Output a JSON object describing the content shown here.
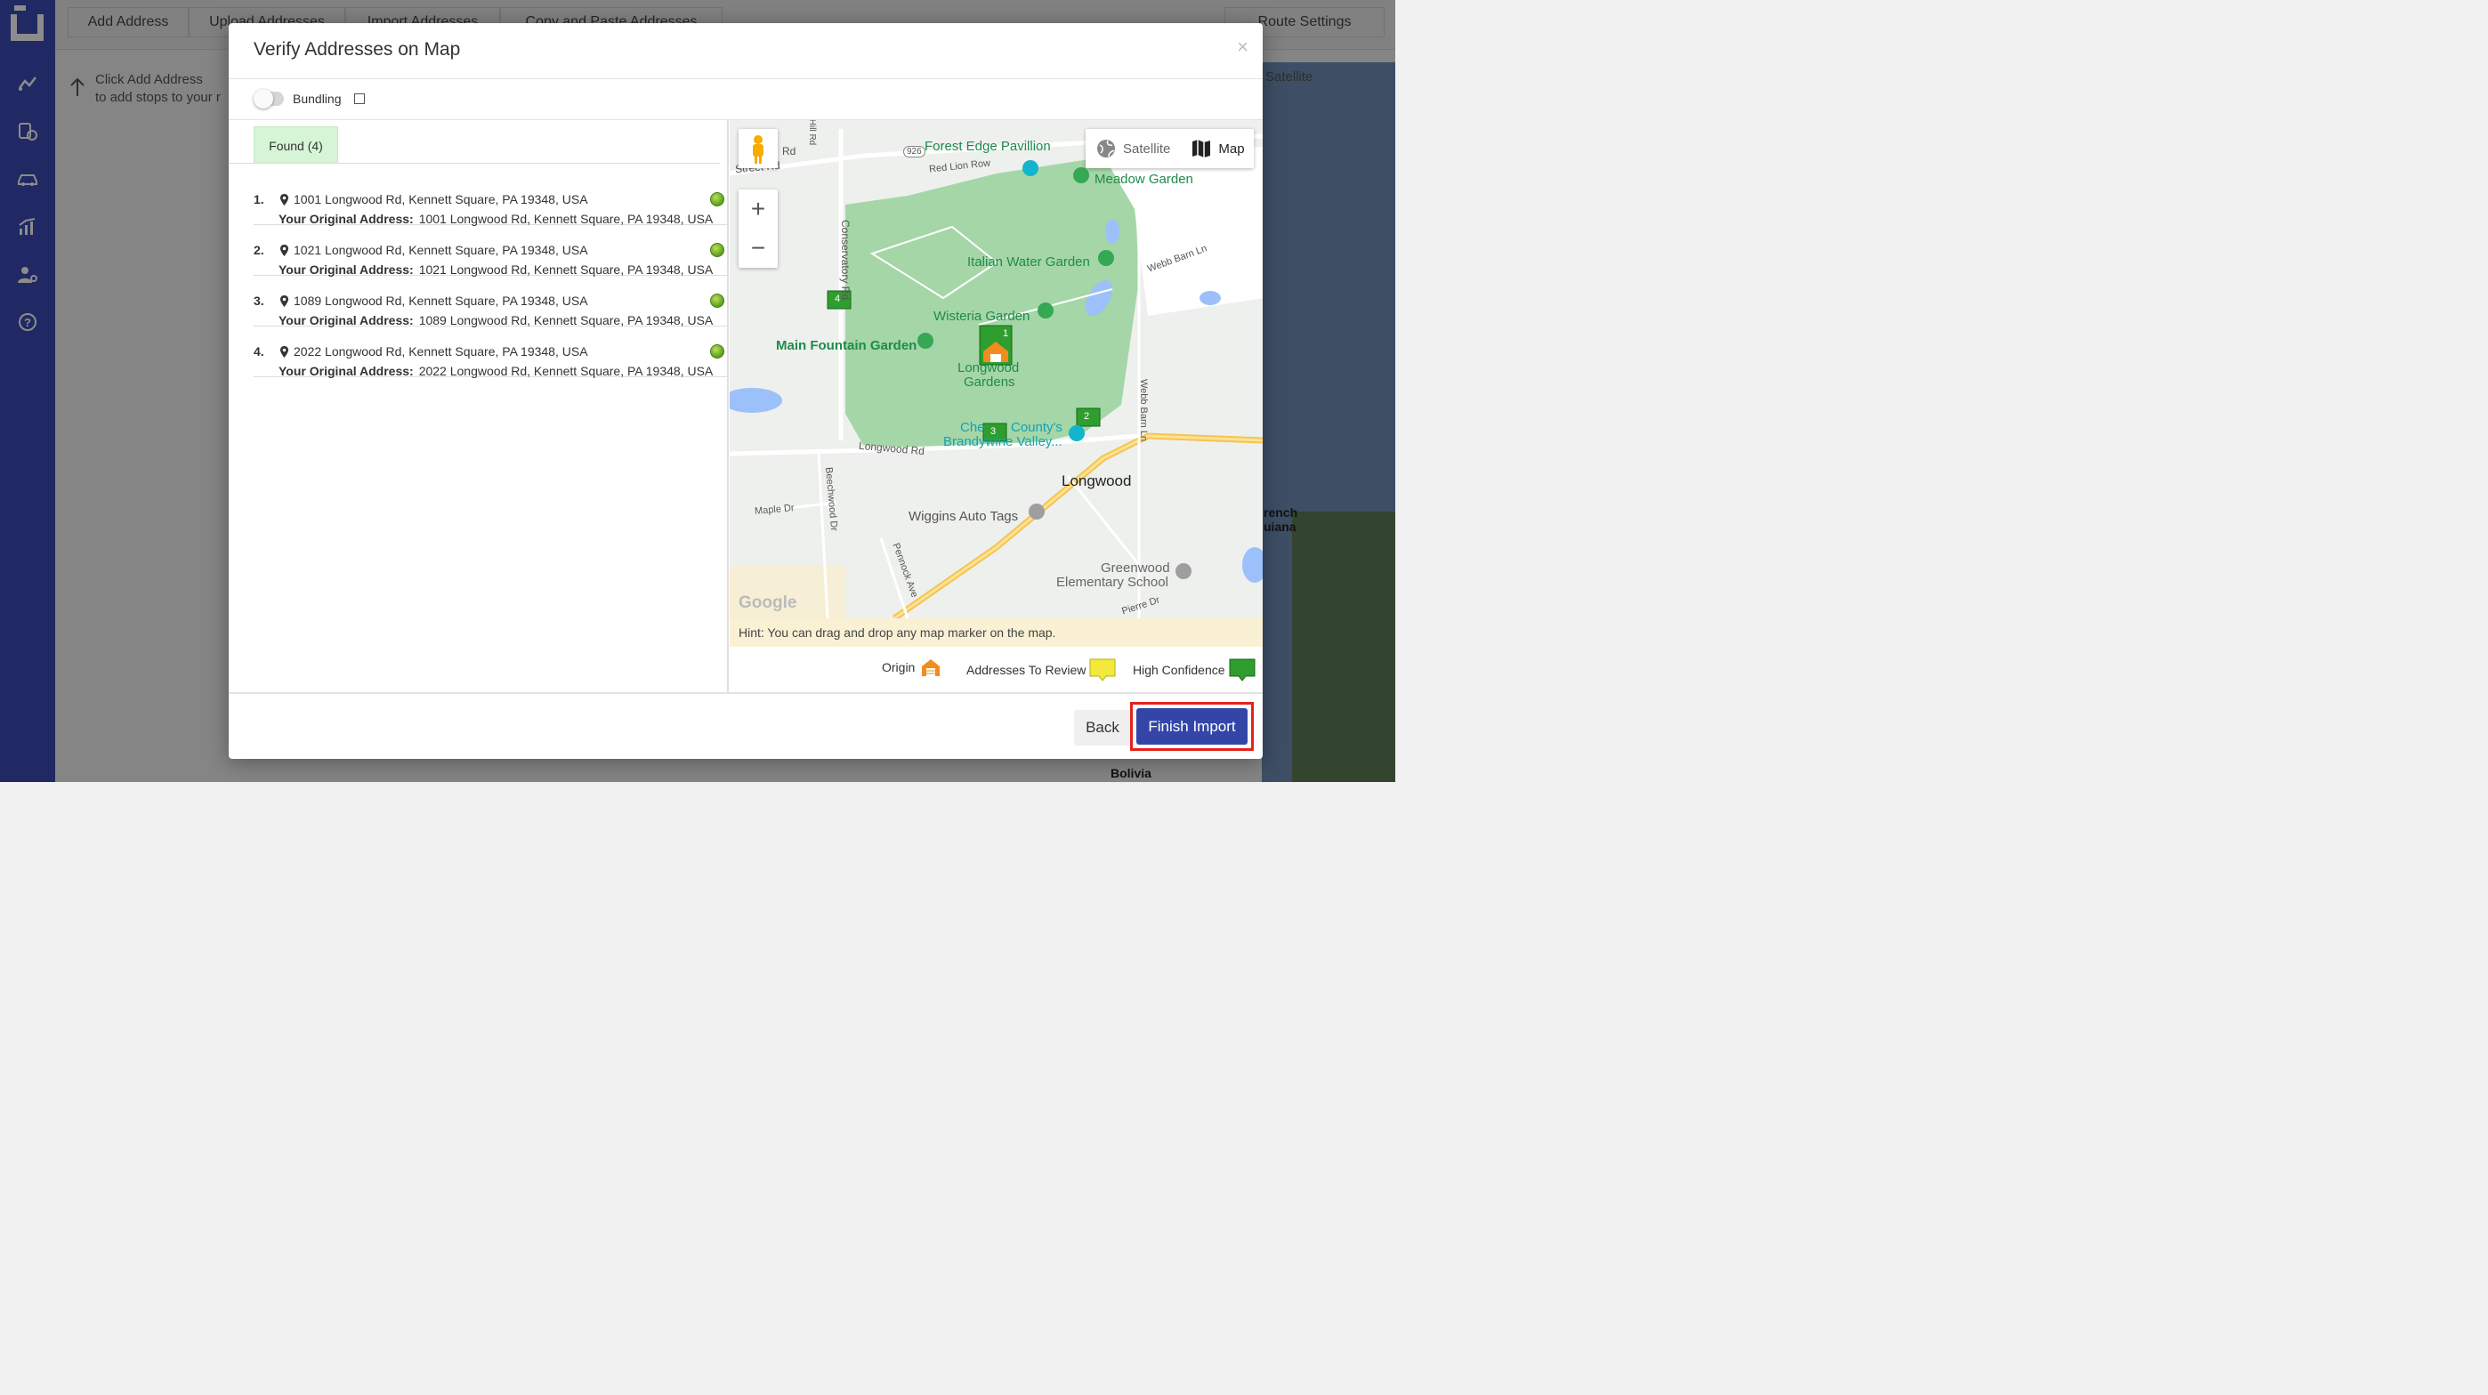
{
  "toolbar": {
    "tabs": [
      "Add Address",
      "Upload Addresses",
      "Import Addresses",
      "Copy and Paste Addresses"
    ],
    "route_settings": "Route Settings"
  },
  "background": {
    "hint_line1": "Click Add Address",
    "hint_line2": "to add stops to your r",
    "satellite": "Satellite",
    "map_label_french": "rench",
    "map_label_guiana": "uiana",
    "map_label_bolivia": "Bolivia"
  },
  "modal": {
    "title": "Verify Addresses on Map",
    "close": "×",
    "bundling_label": "Bundling",
    "found_tab": "Found (4)",
    "original_label": "Your Original Address:",
    "addresses": [
      {
        "num": "1.",
        "address": "1001 Longwood Rd, Kennett Square, PA 19348, USA",
        "original": "1001 Longwood Rd, Kennett Square, PA 19348, USA"
      },
      {
        "num": "2.",
        "address": "1021 Longwood Rd, Kennett Square, PA 19348, USA",
        "original": "1021 Longwood Rd, Kennett Square, PA 19348, USA"
      },
      {
        "num": "3.",
        "address": "1089 Longwood Rd, Kennett Square, PA 19348, USA",
        "original": "1089 Longwood Rd, Kennett Square, PA 19348, USA"
      },
      {
        "num": "4.",
        "address": "2022 Longwood Rd, Kennett Square, PA 19348, USA",
        "original": "2022 Longwood Rd, Kennett Square, PA 19348, USA"
      }
    ],
    "map": {
      "satellite": "Satellite",
      "map": "Map",
      "zoom_in": "+",
      "zoom_out": "−",
      "google": "Google",
      "labels": {
        "forest_edge": "Forest Edge Pavillion",
        "meadow": "Meadow Garden",
        "italian": "Italian Water Garden",
        "wisteria": "Wisteria Garden",
        "main_fountain": "Main Fountain Garden",
        "longwood_gardens_1": "Longwood",
        "longwood_gardens_2": "Gardens",
        "county_1": "Che",
        "county_2": "County's",
        "brandywine": "Brandywine Valley...",
        "longwood": "Longwood",
        "wiggins": "Wiggins Auto Tags",
        "greenwood_1": "Greenwood",
        "greenwood_2": "Elementary School",
        "conservatory": "Conservatory Rd",
        "longwood_rd": "Longwood Rd",
        "street_rd": "Street Rd",
        "rd": "Rd",
        "red_lion": "Red Lion Row",
        "webb_barn": "Webb Barn Ln",
        "webb_barn_v": "Webb Barn Ln",
        "beechwood": "Beechwood Dr",
        "maple": "Maple Dr",
        "pennock": "Pennock Ave",
        "pierre": "Pierre Dr",
        "route_926": "926",
        "hill_rd": "Hill Rd"
      },
      "markers": [
        "1",
        "2",
        "3",
        "4"
      ]
    },
    "hint": "Hint: You can drag and drop any map marker on the map.",
    "legend": {
      "origin": "Origin",
      "review": "Addresses To Review",
      "high": "High Confidence"
    },
    "back": "Back",
    "finish": "Finish Import"
  },
  "colors": {
    "sidebar": "#3b4bb5",
    "primary_button": "#3346a8",
    "highlight": "#e6211b",
    "high_confidence": "#2e9e2e",
    "review": "#f2e93a",
    "origin": "#f28c1e"
  }
}
